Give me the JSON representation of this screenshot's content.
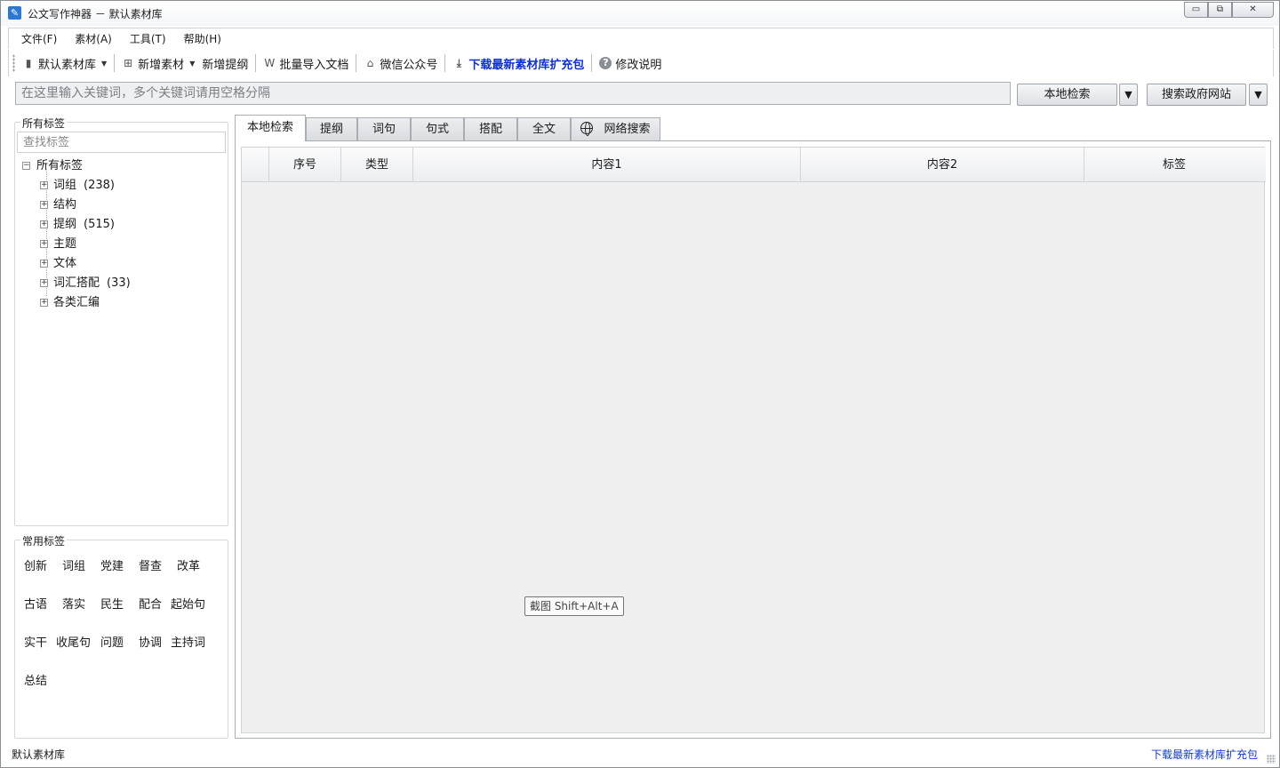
{
  "window": {
    "title": "公文写作神器 －  默认素材库",
    "btn_min": "▭",
    "btn_restore": "⧉",
    "btn_close": "✕"
  },
  "menu": [
    {
      "label": "文件(F)"
    },
    {
      "label": "素材(A)"
    },
    {
      "label": "工具(T)"
    },
    {
      "label": "帮助(H)"
    }
  ],
  "toolbar": {
    "library": "默认素材库",
    "add_material": "新增素材",
    "add_outline": "新增提纲",
    "batch_import": "批量导入文档",
    "wechat": "微信公众号",
    "download": "下载最新素材库扩充包",
    "changelog": "修改说明"
  },
  "search": {
    "placeholder": "在这里输入关键词，多个关键词请用空格分隔",
    "value": "",
    "local_button": "本地检索",
    "gov_button": "搜索政府网站",
    "dropdown_glyph": "▼"
  },
  "tags_panel": {
    "title": "所有标签",
    "search_placeholder": "查找标签",
    "root_label": "所有标签",
    "items": [
      {
        "label": "词组",
        "count": "(238)"
      },
      {
        "label": "结构",
        "count": ""
      },
      {
        "label": "提纲",
        "count": "(515)"
      },
      {
        "label": "主题",
        "count": ""
      },
      {
        "label": "文体",
        "count": ""
      },
      {
        "label": "词汇搭配",
        "count": "(33)"
      },
      {
        "label": "各类汇编",
        "count": ""
      }
    ]
  },
  "common_tags": {
    "title": "常用标签",
    "tags": [
      "创新",
      "词组",
      "党建",
      "督查",
      "改革",
      "古语",
      "落实",
      "民生",
      "配合",
      "起始句",
      "实干",
      "收尾句",
      "问题",
      "协调",
      "主持词",
      "总结"
    ]
  },
  "tabs": [
    {
      "label": "本地检索",
      "active": true
    },
    {
      "label": "提纲",
      "active": false
    },
    {
      "label": "词句",
      "active": false
    },
    {
      "label": "句式",
      "active": false
    },
    {
      "label": "搭配",
      "active": false
    },
    {
      "label": "全文",
      "active": false
    },
    {
      "label": "网络搜索",
      "active": false
    }
  ],
  "grid": {
    "columns": [
      "",
      "序号",
      "类型",
      "内容1",
      "内容2",
      "标签"
    ]
  },
  "tooltip": "截图 Shift+Alt+A",
  "status": {
    "left": "默认素材库",
    "right_link": "下载最新素材库扩充包"
  }
}
